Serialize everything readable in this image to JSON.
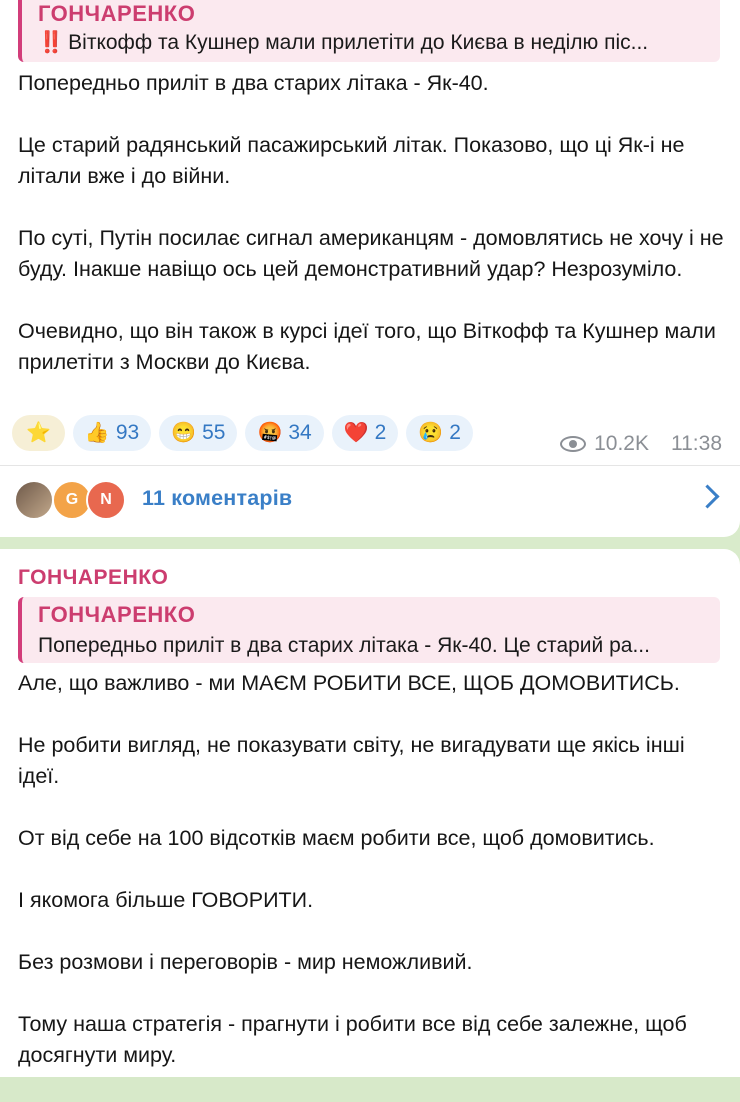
{
  "post1": {
    "reply": {
      "name": "ГОНЧАРЕНКО",
      "mark": "‼️",
      "text": "Віткофф та Кушнер мали прилетіти до Києва в неділю піс..."
    },
    "paragraphs": [
      "Попередньо приліт в два старих літака - Як-40.",
      "Це старий радянський пасажирський літак. Показово, що ці Як-і не літали вже і до війни.",
      "По суті, Путін посилає сигнал американцям - домовлятись не хочу і не буду. Інакше навіщо ось цей демонстративний удар? Незрозуміло.",
      "Очевидно, що він також в курсі ідеї того, що Віткофф та Кушнер мали прилетіти з Москви до Києва."
    ],
    "reactions": [
      {
        "emoji": "⭐",
        "count": ""
      },
      {
        "emoji": "👍",
        "count": "93"
      },
      {
        "emoji": "😁",
        "count": "55"
      },
      {
        "emoji": "🤬",
        "count": "34"
      },
      {
        "emoji": "❤️",
        "count": "2"
      },
      {
        "emoji": "😢",
        "count": "2"
      }
    ],
    "views": "10.2K",
    "time": "11:38",
    "comments": {
      "avatars": [
        "",
        "G",
        "N"
      ],
      "label": "11 коментарів"
    }
  },
  "post2": {
    "author": "ГОНЧАРЕНКО",
    "reply": {
      "name": "ГОНЧАРЕНКО",
      "text": "Попередньо приліт в два старих літака - Як-40.   Це старий ра..."
    },
    "paragraphs": [
      "Але, що важливо - ми МАЄМ РОБИТИ ВСЕ, ЩОБ ДОМОВИТИСЬ.",
      "Не робити вигляд, не показувати світу, не вигадувати ще якісь інші ідеї.",
      "От від себе на 100 відсотків маєм робити все, щоб домовитись.",
      "І якомога більше ГОВОРИТИ.",
      "Без розмови і переговорів - мир неможливий.",
      "Тому наша стратегія - прагнути і робити все від себе залежне, щоб досягнути миру."
    ]
  },
  "colors": {
    "accent_name": "#cc3d6f",
    "link": "#3a7fc7",
    "chat_bg": "#d9ebcb"
  }
}
